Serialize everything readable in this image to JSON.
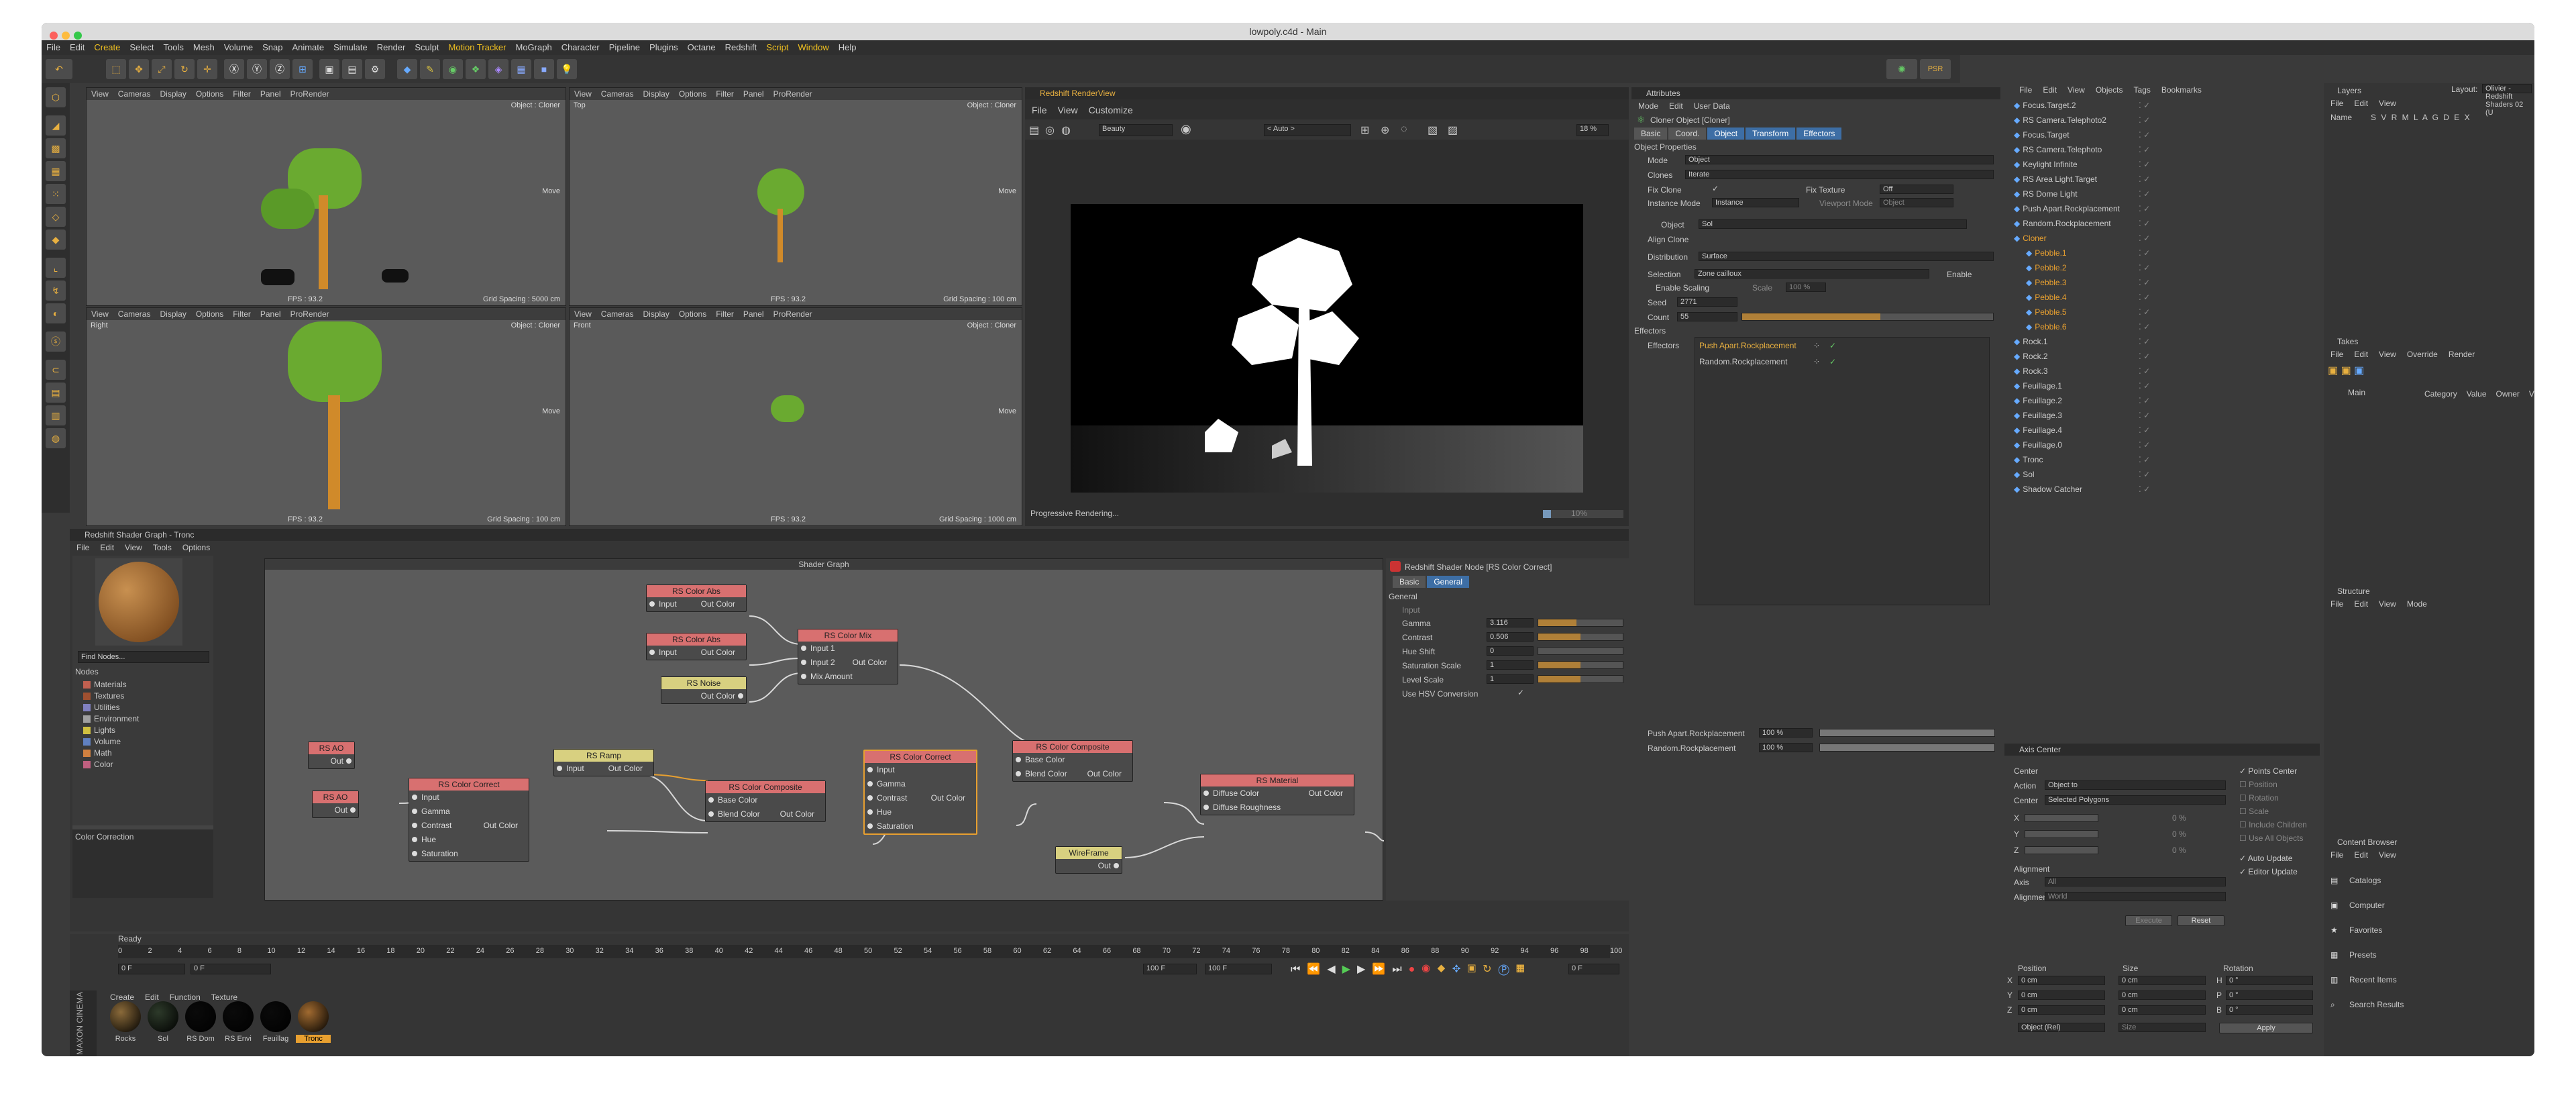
{
  "window": {
    "title": "lowpoly.c4d - Main"
  },
  "menubar": [
    "File",
    "Edit",
    "Create",
    "Select",
    "Tools",
    "Mesh",
    "Volume",
    "Snap",
    "Animate",
    "Simulate",
    "Render",
    "Sculpt",
    "Motion Tracker",
    "MoGraph",
    "Character",
    "Pipeline",
    "Plugins",
    "Octane",
    "Redshift",
    "Script",
    "Window",
    "Help"
  ],
  "layout": {
    "label": "Layout:",
    "value": "Olivier - Redshift Shaders 02 (U"
  },
  "viewports": [
    {
      "menu": [
        "View",
        "Cameras",
        "Display",
        "Options",
        "Filter",
        "Panel",
        "ProRender"
      ],
      "label": "Object : Cloner",
      "fps": "FPS : 93.2",
      "grid": "Grid Spacing : 5000 cm",
      "move": "Move"
    },
    {
      "menu": [
        "View",
        "Cameras",
        "Display",
        "Options",
        "Filter",
        "Panel",
        "ProRender"
      ],
      "name": "Top",
      "label": "Object : Cloner",
      "fps": "FPS : 93.2",
      "grid": "Grid Spacing : 100 cm",
      "move": "Move"
    },
    {
      "menu": [
        "View",
        "Cameras",
        "Display",
        "Options",
        "Filter",
        "Panel",
        "ProRender"
      ],
      "name": "Right",
      "label": "Object : Cloner",
      "fps": "FPS : 93.2",
      "grid": "Grid Spacing : 100 cm",
      "move": "Move"
    },
    {
      "menu": [
        "View",
        "Cameras",
        "Display",
        "Options",
        "Filter",
        "Panel",
        "ProRender"
      ],
      "name": "Front",
      "label": "Object : Cloner",
      "fps": "FPS : 93.2",
      "grid": "Grid Spacing : 1000 cm",
      "move": "Move"
    }
  ],
  "renderview": {
    "title": "Redshift RenderView",
    "menu": [
      "File",
      "View",
      "Customize"
    ],
    "aov": "Beauty",
    "camera": "< Auto >",
    "zoom": "18 %",
    "status": "Progressive Rendering...",
    "progress": "10%"
  },
  "shadergraph": {
    "title": "Redshift Shader Graph - Tronc",
    "menu": [
      "File",
      "Edit",
      "View",
      "Tools",
      "Options"
    ],
    "graph_title": "Shader Graph",
    "find": "Find Nodes...",
    "nodes_label": "Nodes",
    "categories": [
      "Materials",
      "Textures",
      "Utilities",
      "Environment",
      "Lights",
      "Volume",
      "Math",
      "Color"
    ],
    "description": "Color Correction",
    "nodes": {
      "abs1": {
        "title": "RS Color Abs",
        "in": "Input",
        "out": "Out Color"
      },
      "abs2": {
        "title": "RS Color Abs",
        "in": "Input",
        "out": "Out Color"
      },
      "noise": {
        "title": "RS Noise",
        "out": "Out Color"
      },
      "mix": {
        "title": "RS Color Mix",
        "p1": "Input 1",
        "p2": "Input 2",
        "p3": "Mix Amount",
        "out": "Out Color"
      },
      "ao1": {
        "title": "RS AO",
        "out": "Out"
      },
      "ao2": {
        "title": "RS AO",
        "out": "Out"
      },
      "ramp": {
        "title": "RS Ramp",
        "in": "Input",
        "out": "Out Color"
      },
      "cc1": {
        "title": "RS Color Correct",
        "p1": "Input",
        "p2": "Gamma",
        "p3": "Contrast",
        "p4": "Hue",
        "p5": "Saturation",
        "out": "Out Color"
      },
      "comp1": {
        "title": "RS Color Composite",
        "p1": "Base Color",
        "p2": "Blend Color",
        "out": "Out Color"
      },
      "cc2": {
        "title": "RS Color Correct",
        "p1": "Input",
        "p2": "Gamma",
        "p3": "Contrast",
        "p4": "Hue",
        "p5": "Saturation",
        "out": "Out Color"
      },
      "comp2": {
        "title": "RS Color Composite",
        "p1": "Base Color",
        "p2": "Blend Color",
        "out": "Out Color"
      },
      "wire": {
        "title": "WireFrame",
        "out": "Out"
      },
      "mat": {
        "title": "RS Material",
        "p1": "Diffuse Color",
        "p2": "Diffuse Roughness",
        "out": "Out Color"
      }
    },
    "props": {
      "title": "Redshift Shader Node [RS Color Correct]",
      "tabs": [
        "Basic",
        "General"
      ],
      "section": "General",
      "input": "Input",
      "rows": [
        {
          "label": "Gamma",
          "value": "3.116",
          "fill": 0.45
        },
        {
          "label": "Contrast",
          "value": "0.506",
          "fill": 0.5
        },
        {
          "label": "Hue Shift",
          "value": "0",
          "fill": 0.0
        },
        {
          "label": "Saturation Scale",
          "value": "1",
          "fill": 0.5
        },
        {
          "label": "Level Scale",
          "value": "1",
          "fill": 0.5
        }
      ],
      "hsv": "Use HSV Conversion"
    }
  },
  "timeline": {
    "ready": "Ready",
    "ticks": [
      "0",
      "2",
      "4",
      "6",
      "8",
      "10",
      "12",
      "14",
      "16",
      "18",
      "20",
      "22",
      "24",
      "26",
      "28",
      "30",
      "32",
      "34",
      "36",
      "38",
      "40",
      "42",
      "44",
      "46",
      "48",
      "50",
      "52",
      "54",
      "56",
      "58",
      "60",
      "62",
      "64",
      "66",
      "68",
      "70",
      "72",
      "74",
      "76",
      "78",
      "80",
      "82",
      "84",
      "86",
      "88",
      "90",
      "92",
      "94",
      "96",
      "98",
      "100"
    ],
    "start": "0 F",
    "current": "0 F",
    "end": "100 F",
    "end2": "100 F",
    "frame": "0 F"
  },
  "materials": {
    "menu": [
      "Create",
      "Edit",
      "Function",
      "Texture"
    ],
    "items": [
      {
        "name": "Rocks",
        "color": "#8a6a3a"
      },
      {
        "name": "Sol",
        "color": "#2d3a2a"
      },
      {
        "name": "RS Dom",
        "color": "#0a0a0a"
      },
      {
        "name": "RS Envi",
        "color": "#0a0a0a"
      },
      {
        "name": "Feuillag",
        "color": "#0a0a0a"
      },
      {
        "name": "Tronc",
        "color": "#a06a30"
      }
    ],
    "brand": "MAXON CINEMA 4D"
  },
  "attributes": {
    "title": "Attributes",
    "menu": [
      "Mode",
      "Edit",
      "User Data"
    ],
    "object": "Cloner Object [Cloner]",
    "tabs": [
      "Basic",
      "Coord.",
      "Object",
      "Transform",
      "Effectors"
    ],
    "section": "Object Properties",
    "mode": {
      "label": "Mode",
      "value": "Object"
    },
    "clones": {
      "label": "Clones",
      "value": "Iterate"
    },
    "fixclone": "Fix Clone",
    "fixtexture": {
      "label": "Fix Texture",
      "value": "Off"
    },
    "instmode": {
      "label": "Instance Mode",
      "value": "Instance"
    },
    "viewmode": {
      "label": "Viewport Mode",
      "value": "Object"
    },
    "objfield": {
      "label": "Object",
      "value": "Sol"
    },
    "align": "Align Clone",
    "distribution": {
      "label": "Distribution",
      "value": "Surface"
    },
    "selection": {
      "label": "Selection",
      "value": "Zone cailloux"
    },
    "enable": "Enable",
    "scaling": "Enable Scaling",
    "scale": {
      "label": "Scale",
      "value": "100 %"
    },
    "seed": {
      "label": "Seed",
      "value": "2771"
    },
    "count": {
      "label": "Count",
      "value": "55",
      "fill": 0.55
    },
    "effectors_section": "Effectors",
    "effectors_label": "Effectors",
    "effectors": [
      "Push Apart.Rockplacement",
      "Random.Rockplacement"
    ],
    "strengths": [
      {
        "label": "Push Apart.Rockplacement",
        "value": "100 %"
      },
      {
        "label": "Random.Rockplacement",
        "value": "100 %"
      }
    ]
  },
  "objects": {
    "menu": [
      "File",
      "Edit",
      "View",
      "Objects",
      "Tags",
      "Bookmarks"
    ],
    "items": [
      {
        "name": "Focus.Target.2",
        "indent": 0
      },
      {
        "name": "RS Camera.Telephoto2",
        "indent": 0
      },
      {
        "name": "Focus.Target",
        "indent": 0
      },
      {
        "name": "RS Camera.Telephoto",
        "indent": 0
      },
      {
        "name": "Keylight Infinite",
        "indent": 0
      },
      {
        "name": "RS Area Light.Target",
        "indent": 0
      },
      {
        "name": "RS Dome Light",
        "indent": 0
      },
      {
        "name": "Push Apart.Rockplacement",
        "indent": 0
      },
      {
        "name": "Random.Rockplacement",
        "indent": 0
      },
      {
        "name": "Cloner",
        "indent": 0,
        "hl": true
      },
      {
        "name": "Pebble.1",
        "indent": 1,
        "hl": true
      },
      {
        "name": "Pebble.2",
        "indent": 1,
        "hl": true
      },
      {
        "name": "Pebble.3",
        "indent": 1,
        "hl": true
      },
      {
        "name": "Pebble.4",
        "indent": 1,
        "hl": true
      },
      {
        "name": "Pebble.5",
        "indent": 1,
        "hl": true
      },
      {
        "name": "Pebble.6",
        "indent": 1,
        "hl": true
      },
      {
        "name": "Rock.1",
        "indent": 0
      },
      {
        "name": "Rock.2",
        "indent": 0
      },
      {
        "name": "Rock.3",
        "indent": 0
      },
      {
        "name": "Feuillage.1",
        "indent": 0
      },
      {
        "name": "Feuillage.2",
        "indent": 0
      },
      {
        "name": "Feuillage.3",
        "indent": 0
      },
      {
        "name": "Feuillage.4",
        "indent": 0
      },
      {
        "name": "Feuillage.0",
        "indent": 0
      },
      {
        "name": "Tronc",
        "indent": 0
      },
      {
        "name": "Sol",
        "indent": 0
      },
      {
        "name": "Shadow Catcher",
        "indent": 0
      }
    ]
  },
  "axis": {
    "title": "Axis Center",
    "center": "Center",
    "action": {
      "label": "Action",
      "value": "Object to"
    },
    "centerfield": {
      "label": "Center",
      "value": "Selected Polygons"
    },
    "x": "X",
    "y": "Y",
    "z": "Z",
    "pct": "0 %",
    "alignment": "Alignment",
    "axis_lbl": "Axis",
    "axis_val": "All",
    "align_lbl": "Alignment",
    "align_val": "World",
    "checks": [
      "Points Center",
      "Position",
      "Rotation",
      "Scale",
      "Include Children",
      "Use All Objects",
      "Auto Update",
      "Editor Update"
    ],
    "execute": "Execute",
    "reset": "Reset"
  },
  "coords": {
    "position": "Position",
    "size": "Size",
    "rotation": "Rotation",
    "rows": [
      {
        "axis": "X",
        "pos": "0 cm",
        "size": "0 cm",
        "rl": "H",
        "rot": "0 °"
      },
      {
        "axis": "Y",
        "pos": "0 cm",
        "size": "0 cm",
        "rl": "P",
        "rot": "0 °"
      },
      {
        "axis": "Z",
        "pos": "0 cm",
        "size": "0 cm",
        "rl": "B",
        "rot": "0 °"
      }
    ],
    "mode": "Object (Rel)",
    "sizemode": "Size",
    "apply": "Apply"
  },
  "layers": {
    "title": "Layers",
    "menu": [
      "File",
      "Edit",
      "View"
    ],
    "name": "Name",
    "cols": "S V R M L A G D E X"
  },
  "takes": {
    "title": "Takes",
    "menu": [
      "File",
      "Edit",
      "View",
      "Override",
      "Render"
    ],
    "main": "Main",
    "cols": [
      "Category",
      "Value",
      "Owner",
      "V"
    ]
  },
  "structure": {
    "title": "Structure",
    "menu": [
      "File",
      "Edit",
      "View",
      "Mode"
    ]
  },
  "content": {
    "title": "Content Browser",
    "menu": [
      "File",
      "Edit",
      "View"
    ],
    "items": [
      "Catalogs",
      "Computer",
      "Favorites",
      "Presets",
      "Recent Items",
      "Search Results"
    ]
  }
}
